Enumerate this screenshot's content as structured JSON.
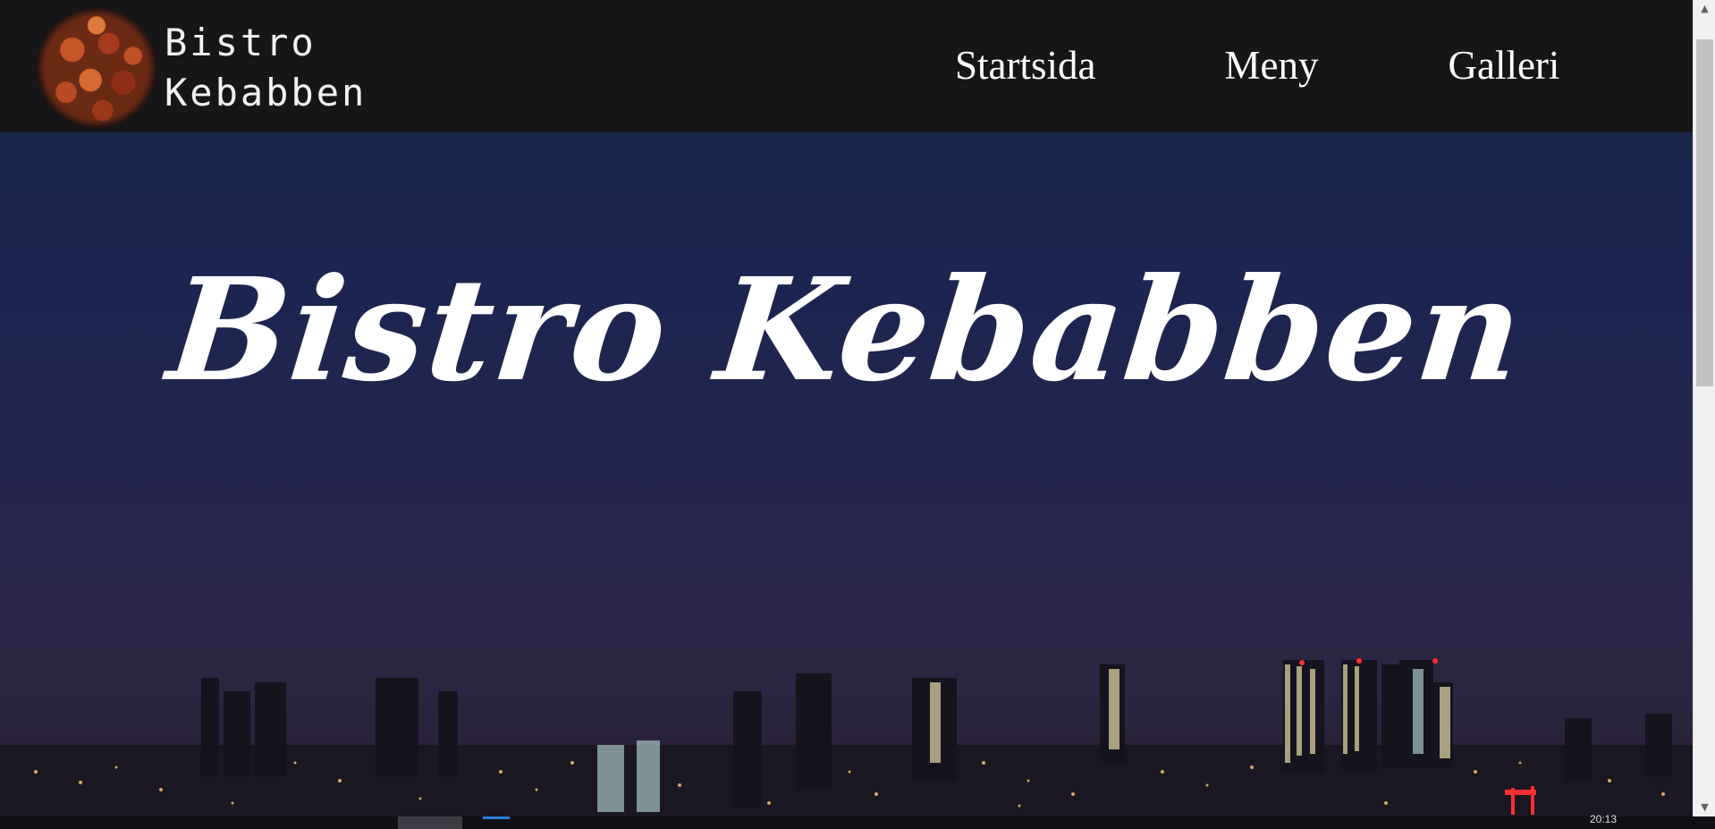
{
  "site": {
    "logo_line1": "Bistro",
    "logo_line2": "Kebabben"
  },
  "nav": {
    "items": [
      {
        "label": "Startsida"
      },
      {
        "label": "Meny"
      },
      {
        "label": "Galleri"
      }
    ]
  },
  "hero": {
    "title": "Bistro Kebabben"
  },
  "taskbar": {
    "clock": "20:13"
  },
  "colors": {
    "header_bg": "#161618",
    "sky_top": "#18264c",
    "sky_bottom": "#2a2540",
    "text": "#ffffff"
  }
}
